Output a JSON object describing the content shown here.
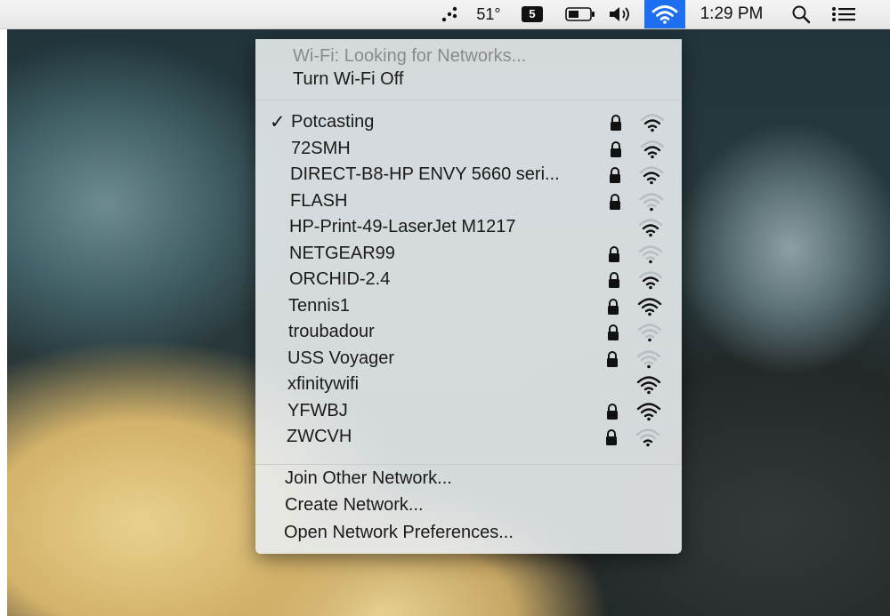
{
  "menubar": {
    "weather": "51°",
    "badge": "5",
    "clock": "1:29 PM",
    "icons": [
      "dots-icon",
      "battery-icon",
      "volume-icon",
      "wifi-icon",
      "search-icon",
      "list-icon"
    ],
    "wifi_highlight_color": "#1e6ff0"
  },
  "wifi_menu": {
    "status": "Wi-Fi: Looking for Networks...",
    "toggle": "Turn Wi-Fi Off",
    "networks": [
      {
        "name": "Potcasting",
        "connected": true,
        "locked": true,
        "strength": 3
      },
      {
        "name": "72SMH",
        "connected": false,
        "locked": true,
        "strength": 3
      },
      {
        "name": "DIRECT-B8-HP ENVY 5660 seri...",
        "connected": false,
        "locked": true,
        "strength": 3
      },
      {
        "name": "FLASH",
        "connected": false,
        "locked": true,
        "strength": 1
      },
      {
        "name": "HP-Print-49-LaserJet M1217",
        "connected": false,
        "locked": false,
        "strength": 3
      },
      {
        "name": "NETGEAR99",
        "connected": false,
        "locked": true,
        "strength": 1
      },
      {
        "name": "ORCHID-2.4",
        "connected": false,
        "locked": true,
        "strength": 3
      },
      {
        "name": "Tennis1",
        "connected": false,
        "locked": true,
        "strength": 4
      },
      {
        "name": "troubadour",
        "connected": false,
        "locked": true,
        "strength": 1
      },
      {
        "name": "USS Voyager",
        "connected": false,
        "locked": true,
        "strength": 1
      },
      {
        "name": "xfinitywifi",
        "connected": false,
        "locked": false,
        "strength": 4
      },
      {
        "name": "YFWBJ",
        "connected": false,
        "locked": true,
        "strength": 4
      },
      {
        "name": "ZWCVH",
        "connected": false,
        "locked": true,
        "strength": 2
      }
    ],
    "actions": {
      "join_other": "Join Other Network...",
      "create": "Create Network...",
      "open_prefs": "Open Network Preferences..."
    },
    "checkmark": "✓"
  }
}
